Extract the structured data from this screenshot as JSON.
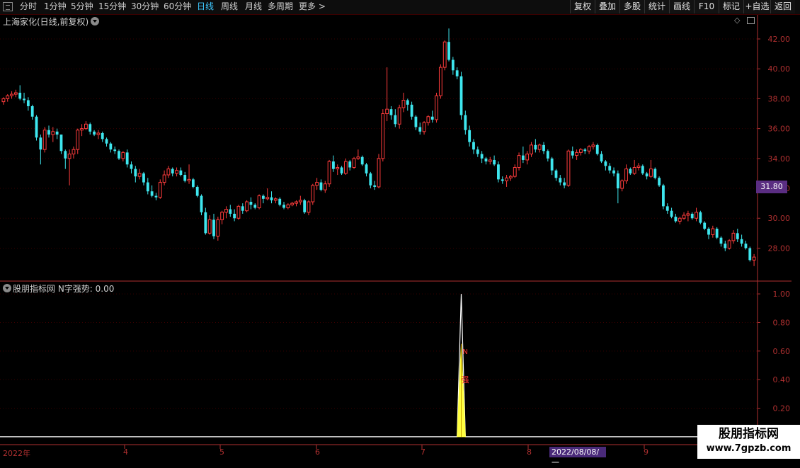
{
  "toolbar": {
    "periods": [
      "分时",
      "1分钟",
      "5分钟",
      "15分钟",
      "30分钟",
      "60分钟",
      "日线",
      "周线",
      "月线",
      "多周期",
      "更多 >"
    ],
    "active_period": "日线",
    "right_buttons": [
      "复权",
      "叠加",
      "多股",
      "统计",
      "画线",
      "F10",
      "标记",
      "+自选",
      "返回"
    ]
  },
  "main_chart": {
    "title": "上海家化(日线,前复权)",
    "current_price_tag": "31.80",
    "colors": {
      "up": "#ff3c3c",
      "down": "#3ee6ee",
      "grid": "#3a0000",
      "axis": "#b03030"
    }
  },
  "indicator": {
    "title": "股朋指标网  N字强势: 0.00",
    "spike_labels": [
      "N",
      "强"
    ]
  },
  "x_axis": {
    "labels": [
      "2022年",
      "4",
      "5",
      "6",
      "7",
      "8",
      "9"
    ],
    "cursor_date": "2022/08/08/一"
  },
  "watermark": {
    "line1": "股朋指标网",
    "line2": "www.7gpzb.com"
  },
  "chart_data": [
    {
      "type": "candlestick",
      "title": "上海家化(日线,前复权)",
      "y_ticks": [
        28.0,
        30.0,
        32.0,
        34.0,
        36.0,
        38.0,
        40.0,
        42.0
      ],
      "ylim": [
        26.6,
        42.9
      ],
      "candles": [
        [
          37.8,
          38.1,
          37.6,
          38.0
        ],
        [
          38.0,
          38.3,
          37.8,
          38.2
        ],
        [
          38.2,
          38.5,
          38.0,
          38.3
        ],
        [
          38.3,
          38.6,
          38.1,
          38.4
        ],
        [
          38.4,
          38.9,
          37.9,
          38.0
        ],
        [
          38.0,
          38.4,
          37.7,
          37.9
        ],
        [
          37.9,
          38.1,
          37.2,
          37.5
        ],
        [
          37.5,
          37.6,
          36.6,
          36.8
        ],
        [
          36.8,
          36.9,
          35.2,
          35.4
        ],
        [
          35.4,
          35.6,
          33.6,
          34.6
        ],
        [
          34.6,
          36.1,
          34.4,
          35.9
        ],
        [
          35.9,
          36.2,
          35.4,
          35.6
        ],
        [
          35.6,
          36.1,
          35.1,
          35.8
        ],
        [
          35.8,
          36.0,
          35.3,
          35.6
        ],
        [
          35.6,
          35.6,
          34.3,
          34.5
        ],
        [
          34.5,
          34.6,
          33.3,
          34.0
        ],
        [
          34.0,
          34.6,
          32.2,
          34.3
        ],
        [
          34.3,
          34.8,
          34.0,
          34.6
        ],
        [
          34.6,
          36.0,
          34.3,
          35.9
        ],
        [
          35.9,
          36.3,
          35.5,
          36.0
        ],
        [
          36.0,
          36.5,
          35.9,
          36.3
        ],
        [
          36.3,
          36.4,
          35.6,
          35.8
        ],
        [
          35.8,
          35.9,
          35.5,
          35.6
        ],
        [
          35.6,
          35.9,
          35.3,
          35.7
        ],
        [
          35.7,
          35.8,
          35.1,
          35.3
        ],
        [
          35.3,
          35.4,
          34.8,
          35.0
        ],
        [
          35.0,
          35.1,
          34.4,
          34.6
        ],
        [
          34.6,
          34.8,
          34.3,
          34.5
        ],
        [
          34.5,
          34.6,
          33.9,
          34.0
        ],
        [
          34.0,
          34.5,
          33.8,
          34.4
        ],
        [
          34.4,
          34.6,
          33.4,
          33.6
        ],
        [
          33.6,
          33.8,
          33.0,
          33.3
        ],
        [
          33.3,
          33.5,
          32.4,
          32.8
        ],
        [
          32.8,
          33.3,
          32.6,
          33.0
        ],
        [
          33.0,
          33.1,
          32.2,
          32.4
        ],
        [
          32.4,
          32.7,
          31.6,
          31.8
        ],
        [
          31.8,
          32.2,
          31.4,
          31.5
        ],
        [
          31.5,
          31.7,
          31.2,
          31.4
        ],
        [
          31.4,
          32.6,
          31.3,
          32.4
        ],
        [
          32.4,
          33.2,
          32.2,
          32.9
        ],
        [
          32.9,
          33.5,
          32.7,
          33.3
        ],
        [
          33.3,
          33.4,
          32.8,
          33.0
        ],
        [
          33.0,
          33.4,
          32.8,
          33.2
        ],
        [
          33.2,
          33.4,
          32.8,
          32.9
        ],
        [
          32.9,
          33.1,
          32.4,
          32.5
        ],
        [
          32.5,
          33.6,
          32.3,
          32.6
        ],
        [
          32.6,
          32.7,
          32.0,
          32.1
        ],
        [
          32.1,
          32.2,
          31.4,
          31.5
        ],
        [
          31.5,
          31.6,
          30.2,
          30.4
        ],
        [
          30.4,
          30.7,
          28.9,
          29.0
        ],
        [
          29.0,
          30.2,
          28.9,
          29.9
        ],
        [
          29.9,
          30.3,
          28.6,
          28.8
        ],
        [
          28.8,
          30.1,
          28.5,
          29.9
        ],
        [
          29.9,
          30.5,
          29.6,
          30.4
        ],
        [
          30.4,
          30.8,
          30.0,
          30.6
        ],
        [
          30.6,
          30.9,
          30.1,
          30.3
        ],
        [
          30.3,
          30.6,
          29.8,
          30.0
        ],
        [
          30.0,
          30.9,
          29.9,
          30.8
        ],
        [
          30.8,
          31.0,
          30.3,
          30.5
        ],
        [
          30.5,
          31.2,
          30.4,
          31.1
        ],
        [
          31.1,
          31.4,
          30.6,
          30.9
        ],
        [
          30.9,
          31.0,
          30.6,
          30.7
        ],
        [
          30.7,
          31.6,
          30.6,
          31.5
        ],
        [
          31.5,
          31.6,
          31.0,
          31.3
        ],
        [
          31.3,
          32.0,
          31.2,
          31.4
        ],
        [
          31.4,
          31.8,
          31.0,
          31.2
        ],
        [
          31.2,
          31.4,
          31.0,
          31.3
        ],
        [
          31.3,
          31.4,
          30.8,
          30.9
        ],
        [
          30.9,
          31.1,
          30.6,
          30.7
        ],
        [
          30.7,
          31.0,
          30.6,
          30.9
        ],
        [
          30.9,
          31.1,
          30.8,
          31.0
        ],
        [
          31.0,
          31.2,
          30.8,
          31.1
        ],
        [
          31.1,
          31.5,
          30.9,
          31.2
        ],
        [
          31.2,
          31.3,
          30.3,
          30.4
        ],
        [
          30.4,
          31.2,
          30.2,
          31.1
        ],
        [
          31.1,
          32.3,
          30.9,
          32.2
        ],
        [
          32.2,
          32.7,
          31.9,
          32.4
        ],
        [
          32.4,
          32.6,
          31.8,
          31.9
        ],
        [
          31.9,
          32.5,
          31.7,
          32.3
        ],
        [
          32.3,
          33.9,
          32.1,
          33.8
        ],
        [
          33.8,
          34.2,
          33.1,
          33.3
        ],
        [
          33.3,
          33.6,
          32.9,
          33.4
        ],
        [
          33.4,
          33.5,
          32.9,
          33.0
        ],
        [
          33.0,
          34.0,
          32.9,
          33.8
        ],
        [
          33.8,
          33.9,
          33.2,
          33.4
        ],
        [
          33.4,
          34.1,
          33.3,
          34.0
        ],
        [
          34.0,
          34.6,
          33.9,
          34.1
        ],
        [
          34.1,
          34.2,
          33.5,
          33.6
        ],
        [
          33.6,
          33.7,
          32.8,
          33.0
        ],
        [
          33.0,
          33.1,
          32.0,
          32.2
        ],
        [
          32.2,
          32.5,
          31.9,
          32.1
        ],
        [
          32.1,
          34.3,
          32.0,
          34.0
        ],
        [
          34.0,
          37.3,
          33.8,
          37.0
        ],
        [
          37.0,
          40.1,
          36.5,
          37.3
        ],
        [
          37.3,
          37.5,
          36.6,
          36.9
        ],
        [
          36.9,
          37.3,
          36.1,
          36.3
        ],
        [
          36.3,
          37.6,
          36.0,
          37.4
        ],
        [
          37.4,
          38.4,
          37.1,
          37.9
        ],
        [
          37.9,
          38.0,
          37.2,
          37.6
        ],
        [
          37.6,
          37.8,
          36.6,
          36.8
        ],
        [
          36.8,
          36.9,
          35.9,
          36.1
        ],
        [
          36.1,
          36.4,
          35.6,
          35.8
        ],
        [
          35.8,
          36.5,
          35.6,
          36.4
        ],
        [
          36.4,
          36.9,
          36.2,
          36.8
        ],
        [
          36.8,
          37.2,
          36.4,
          36.6
        ],
        [
          36.6,
          38.4,
          36.4,
          38.2
        ],
        [
          38.2,
          40.3,
          38.0,
          40.1
        ],
        [
          40.1,
          41.9,
          39.9,
          41.8
        ],
        [
          41.8,
          42.7,
          40.5,
          40.6
        ],
        [
          40.6,
          40.8,
          39.6,
          39.9
        ],
        [
          39.9,
          40.1,
          39.3,
          39.5
        ],
        [
          39.5,
          39.8,
          36.6,
          36.9
        ],
        [
          36.9,
          37.2,
          35.6,
          35.9
        ],
        [
          35.9,
          36.2,
          34.8,
          35.1
        ],
        [
          35.1,
          35.3,
          34.3,
          34.6
        ],
        [
          34.6,
          34.8,
          34.1,
          34.3
        ],
        [
          34.3,
          34.5,
          33.7,
          34.0
        ],
        [
          34.0,
          34.1,
          33.6,
          33.8
        ],
        [
          33.8,
          34.1,
          33.6,
          33.9
        ],
        [
          33.9,
          34.2,
          33.5,
          33.6
        ],
        [
          33.6,
          33.8,
          32.4,
          32.6
        ],
        [
          32.6,
          32.8,
          32.3,
          32.5
        ],
        [
          32.5,
          32.9,
          32.1,
          32.7
        ],
        [
          32.7,
          32.9,
          32.5,
          32.8
        ],
        [
          32.8,
          33.6,
          32.7,
          33.4
        ],
        [
          33.4,
          34.4,
          33.2,
          34.2
        ],
        [
          34.2,
          34.8,
          33.7,
          33.9
        ],
        [
          33.9,
          34.5,
          33.6,
          34.3
        ],
        [
          34.3,
          35.1,
          34.1,
          34.9
        ],
        [
          34.9,
          35.3,
          34.4,
          34.6
        ],
        [
          34.6,
          35.0,
          34.4,
          34.9
        ],
        [
          34.9,
          35.1,
          34.3,
          34.5
        ],
        [
          34.5,
          34.6,
          33.8,
          34.0
        ],
        [
          34.0,
          34.1,
          32.9,
          33.2
        ],
        [
          33.2,
          33.3,
          32.5,
          32.7
        ],
        [
          32.7,
          32.9,
          32.2,
          32.4
        ],
        [
          32.4,
          32.7,
          32.0,
          32.2
        ],
        [
          32.2,
          34.6,
          32.1,
          34.5
        ],
        [
          34.5,
          34.8,
          34.0,
          34.2
        ],
        [
          34.2,
          34.6,
          33.9,
          34.4
        ],
        [
          34.4,
          34.7,
          34.2,
          34.6
        ],
        [
          34.6,
          34.7,
          34.3,
          34.5
        ],
        [
          34.5,
          34.9,
          34.3,
          34.8
        ],
        [
          34.8,
          35.1,
          34.6,
          34.9
        ],
        [
          34.9,
          35.0,
          34.2,
          34.3
        ],
        [
          34.3,
          34.5,
          33.7,
          33.8
        ],
        [
          33.8,
          33.9,
          33.2,
          33.5
        ],
        [
          33.5,
          33.7,
          33.0,
          33.2
        ],
        [
          33.2,
          33.4,
          32.8,
          33.0
        ],
        [
          33.0,
          33.2,
          31.0,
          32.0
        ],
        [
          32.0,
          32.6,
          31.8,
          32.5
        ],
        [
          32.5,
          33.6,
          32.3,
          33.3
        ],
        [
          33.3,
          33.4,
          32.9,
          33.0
        ],
        [
          33.0,
          33.9,
          32.9,
          33.4
        ],
        [
          33.4,
          33.7,
          33.2,
          33.5
        ],
        [
          33.5,
          33.6,
          32.9,
          33.0
        ],
        [
          33.0,
          33.1,
          32.6,
          32.8
        ],
        [
          32.8,
          33.9,
          32.7,
          33.3
        ],
        [
          33.3,
          33.4,
          32.6,
          32.7
        ],
        [
          32.7,
          32.8,
          32.1,
          32.2
        ],
        [
          32.2,
          32.3,
          30.6,
          30.8
        ],
        [
          30.8,
          31.0,
          30.3,
          30.5
        ],
        [
          30.5,
          30.7,
          30.0,
          30.1
        ],
        [
          30.1,
          30.3,
          29.7,
          29.8
        ],
        [
          29.8,
          30.1,
          29.6,
          30.0
        ],
        [
          30.0,
          30.4,
          29.9,
          30.2
        ],
        [
          30.2,
          30.5,
          29.8,
          30.3
        ],
        [
          30.3,
          30.4,
          29.9,
          30.0
        ],
        [
          30.0,
          30.7,
          29.8,
          30.4
        ],
        [
          30.4,
          30.5,
          29.6,
          29.7
        ],
        [
          29.7,
          29.8,
          29.2,
          29.3
        ],
        [
          29.3,
          29.4,
          28.6,
          28.9
        ],
        [
          28.9,
          29.5,
          28.7,
          29.3
        ],
        [
          29.3,
          29.4,
          28.6,
          28.7
        ],
        [
          28.7,
          28.8,
          28.1,
          28.3
        ],
        [
          28.3,
          28.5,
          27.8,
          28.0
        ],
        [
          28.0,
          28.6,
          27.9,
          28.5
        ],
        [
          28.5,
          29.2,
          28.3,
          29.0
        ],
        [
          29.0,
          29.3,
          28.4,
          28.6
        ],
        [
          28.6,
          28.9,
          28.1,
          28.3
        ],
        [
          28.3,
          28.5,
          27.9,
          28.0
        ],
        [
          28.0,
          28.1,
          27.1,
          27.2
        ],
        [
          27.2,
          27.6,
          26.8,
          27.4
        ]
      ]
    },
    {
      "type": "line",
      "title": "股朋指标网  N字强势: 0.00",
      "y_ticks": [
        0.2,
        0.4,
        0.6,
        0.8,
        1.0
      ],
      "ylim": [
        -0.05,
        1.05
      ],
      "series": [
        {
          "values_sparse": {
            "default": 0,
            "111": 1.0
          },
          "color": "#ffffff"
        },
        {
          "values_sparse": {
            "default": 0,
            "111": 0.65
          },
          "color": "#ffff40"
        }
      ]
    }
  ]
}
